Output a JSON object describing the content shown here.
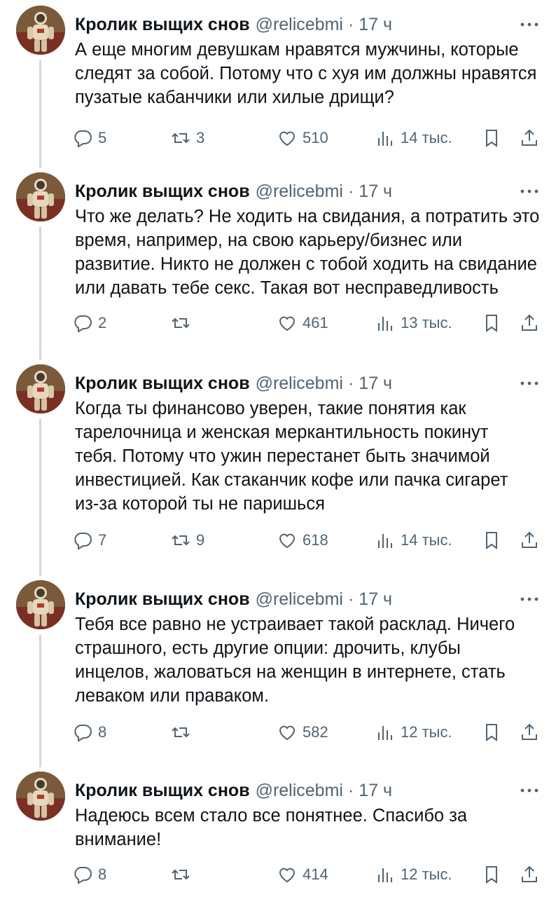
{
  "tweets": [
    {
      "author": "Кролик выщих снов",
      "handle": "@relicebmi",
      "separator": "·",
      "time": "17 ч",
      "lines": [
        "А еще многим девушкам нравятся мужчины, которые",
        "следят за собой. Потому что с хуя им должны нравятся",
        "пузатые кабанчики или хилые дрищи?"
      ],
      "replies": "5",
      "retweets": "3",
      "likes": "510",
      "views": "14 тыс."
    },
    {
      "author": "Кролик выщих снов",
      "handle": "@relicebmi",
      "separator": "·",
      "time": "17 ч",
      "lines": [
        "Что же делать? Не ходить на свидания, а потратить это",
        "время, например, на свою карьеру/бизнес или",
        "развитие. Никто не должен с тобой ходить на свидание",
        "или давать тебе секс. Такая вот несправедливость"
      ],
      "replies": "2",
      "retweets": "",
      "likes": "461",
      "views": "13 тыс."
    },
    {
      "author": "Кролик выщих снов",
      "handle": "@relicebmi",
      "separator": "·",
      "time": "17 ч",
      "lines": [
        "Когда ты финансово уверен, такие понятия как",
        "тарелочница и женская меркантильность покинут",
        "тебя. Потому что ужин перестанет быть значимой",
        "инвестицией. Как стаканчик кофе или пачка сигарет",
        "из-за которой ты не паришься"
      ],
      "replies": "7",
      "retweets": "9",
      "likes": "618",
      "views": "14 тыс."
    },
    {
      "author": "Кролик выщих снов",
      "handle": "@relicebmi",
      "separator": "·",
      "time": "17 ч",
      "lines": [
        "Тебя все равно не устраивает такой расклад. Ничего",
        "страшного, есть другие опции: дрочить, клубы",
        "инцелов, жаловаться на женщин в интернете, стать",
        "леваком или праваком."
      ],
      "replies": "8",
      "retweets": "",
      "likes": "582",
      "views": "12 тыс."
    },
    {
      "author": "Кролик выщих снов",
      "handle": "@relicebmi",
      "separator": "·",
      "time": "17 ч",
      "lines": [
        "Надеюсь всем стало все понятнее. Спасибо за",
        "внимание!"
      ],
      "replies": "8",
      "retweets": "",
      "likes": "414",
      "views": "12 тыс."
    }
  ],
  "icons": {
    "reply": "reply-icon",
    "retweet": "retweet-icon",
    "like": "like-icon",
    "views": "views-icon",
    "bookmark": "bookmark-icon",
    "share": "share-icon",
    "more": "more-icon"
  },
  "colors": {
    "text": "#0f1419",
    "secondary": "#536471",
    "thread_line": "#cfd9de",
    "background": "#ffffff"
  }
}
